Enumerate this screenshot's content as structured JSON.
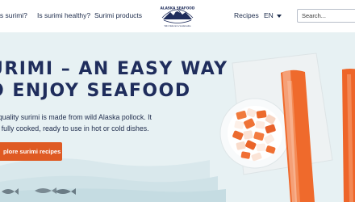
{
  "nav": {
    "links": [
      "is surimi?",
      "Is surimi healthy?",
      "Surimi products"
    ],
    "logo_text": "ALASKA SEAFOOD",
    "logo_tagline": "Wild, Natural & Sustainable",
    "recipes": "Recipes",
    "language": "EN"
  },
  "search": {
    "placeholder": "Search..."
  },
  "hero": {
    "headline_line1": "URIMI – AN EASY WAY",
    "headline_line2": "O ENJOY SEAFOOD",
    "lead_line1": "n-quality surimi is made from wild Alaska pollock. It",
    "lead_line2": "es fully cooked, ready to use in hot or cold dishes.",
    "cta_label": "plore surimi recipes"
  },
  "colors": {
    "navy": "#1f2d5c",
    "accent_orange": "#df5a23",
    "hero_bg": "#e7f1f3",
    "surimi_stick": "#ef6a2c"
  },
  "icons": [
    "chevron-down-icon",
    "alaska-seafood-logo",
    "fish-illustration"
  ]
}
